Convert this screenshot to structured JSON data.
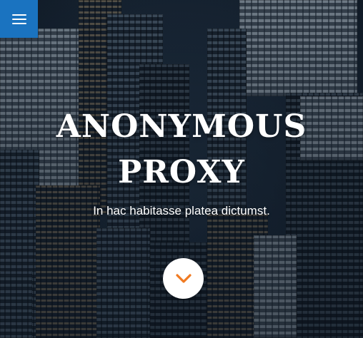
{
  "hero": {
    "title": "ANONYMOUS PROXY",
    "subtitle": "In hac habitasse platea dictumst."
  },
  "menu_button": {
    "icon": "hamburger-menu-icon"
  },
  "scroll_button": {
    "icon": "chevron-down-icon"
  },
  "colors": {
    "menu_button_bg": "#1a73c0",
    "scroll_chevron": "#f07a22",
    "text": "#ffffff"
  }
}
